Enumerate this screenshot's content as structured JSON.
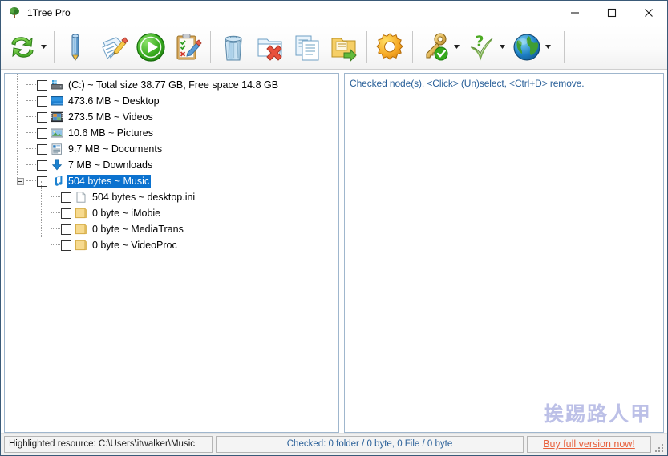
{
  "window": {
    "title": "1Tree Pro",
    "app_icon": "tree-icon",
    "minimize_label": "Minimize",
    "maximize_label": "Maximize",
    "close_label": "Close"
  },
  "toolbar": {
    "items": [
      {
        "name": "refresh-scan-button",
        "icon": "green-recycle-arrows-icon",
        "label": "Rescan",
        "has_dropdown": true
      },
      {
        "type": "separator"
      },
      {
        "name": "rename-button",
        "icon": "blue-pen-icon",
        "label": "Rename",
        "has_dropdown": false
      },
      {
        "name": "edit-document-button",
        "icon": "document-pencil-icon",
        "label": "Edit",
        "has_dropdown": false
      },
      {
        "name": "run-button",
        "icon": "green-play-icon",
        "label": "Run",
        "has_dropdown": false
      },
      {
        "name": "checklist-edit-button",
        "icon": "clipboard-pencil-icon",
        "label": "Check list",
        "has_dropdown": false
      },
      {
        "type": "separator"
      },
      {
        "name": "delete-to-recycle-bin-button",
        "icon": "trash-can-icon",
        "label": "Delete",
        "has_dropdown": false
      },
      {
        "name": "delete-folder-button",
        "icon": "folder-delete-icon",
        "label": "Remove folder",
        "has_dropdown": false
      },
      {
        "name": "copy-button",
        "icon": "copy-documents-icon",
        "label": "Copy",
        "has_dropdown": false
      },
      {
        "name": "move-to-folder-button",
        "icon": "folder-move-icon",
        "label": "Move",
        "has_dropdown": false
      },
      {
        "type": "separator"
      },
      {
        "name": "settings-button",
        "icon": "orange-gear-icon",
        "label": "Options",
        "has_dropdown": false
      },
      {
        "type": "separator"
      },
      {
        "name": "license-button",
        "icon": "key-check-icon",
        "label": "License",
        "has_dropdown": true
      },
      {
        "name": "help-button",
        "icon": "question-check-icon",
        "label": "Help",
        "has_dropdown": true
      },
      {
        "name": "website-button",
        "icon": "globe-icon",
        "label": "Website",
        "has_dropdown": true
      },
      {
        "type": "separator"
      }
    ]
  },
  "tree": {
    "nodes": [
      {
        "level": 0,
        "icon": "drive-icon",
        "label": "(C:) ~ Total size 38.77 GB, Free space 14.8 GB",
        "checked": false,
        "selected": false,
        "expander": "none"
      },
      {
        "level": 0,
        "icon": "desktop-icon",
        "label": "473.6 MB ~ Desktop",
        "checked": false,
        "selected": false,
        "expander": "none"
      },
      {
        "level": 0,
        "icon": "videos-icon",
        "label": "273.5 MB ~ Videos",
        "checked": false,
        "selected": false,
        "expander": "none"
      },
      {
        "level": 0,
        "icon": "pictures-icon",
        "label": "10.6 MB ~ Pictures",
        "checked": false,
        "selected": false,
        "expander": "none"
      },
      {
        "level": 0,
        "icon": "documents-icon",
        "label": "9.7 MB ~ Documents",
        "checked": false,
        "selected": false,
        "expander": "none"
      },
      {
        "level": 0,
        "icon": "downloads-icon",
        "label": "7 MB ~ Downloads",
        "checked": false,
        "selected": false,
        "expander": "none"
      },
      {
        "level": 0,
        "icon": "music-icon",
        "label": "504 bytes ~ Music",
        "checked": false,
        "selected": true,
        "expander": "collapse"
      },
      {
        "level": 1,
        "icon": "file-icon",
        "label": "504 bytes ~ desktop.ini",
        "checked": false,
        "selected": false,
        "expander": "none"
      },
      {
        "level": 1,
        "icon": "folder-icon",
        "label": "0 byte ~ iMobie",
        "checked": false,
        "selected": false,
        "expander": "none"
      },
      {
        "level": 1,
        "icon": "folder-icon",
        "label": "0 byte ~ MediaTrans",
        "checked": false,
        "selected": false,
        "expander": "none"
      },
      {
        "level": 1,
        "icon": "folder-icon",
        "label": "0 byte ~ VideoProc",
        "checked": false,
        "selected": false,
        "expander": "none"
      }
    ]
  },
  "checked_panel": {
    "hint": "Checked node(s). <Click> (Un)select, <Ctrl+D> remove.",
    "watermark": "挨踢路人甲"
  },
  "statusbar": {
    "highlighted": "Highlighted resource: C:\\Users\\itwalker\\Music",
    "checked_summary": "Checked:  0 folder / 0  byte, 0 File / 0  byte",
    "buy_label": "Buy full version now!"
  },
  "colors": {
    "accent_blue": "#0b72cf",
    "hint_blue": "#2a6099",
    "buy_orange": "#e8603c",
    "panel_border": "#9fb6cd",
    "watermark": "#b9bde6"
  }
}
